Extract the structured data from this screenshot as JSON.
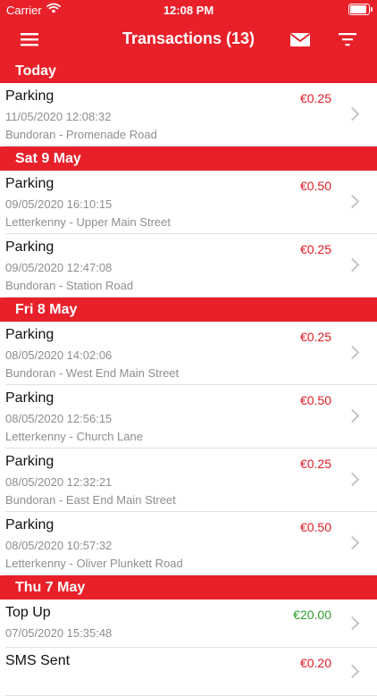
{
  "status": {
    "carrier": "Carrier",
    "time": "12:08 PM",
    "battery_level": 1.0
  },
  "nav": {
    "title": "Transactions (13)"
  },
  "colors": {
    "accent": "#e8202a",
    "negative": "#e01b24",
    "positive": "#2e9a2e"
  },
  "sections": [
    {
      "header": "Today",
      "rows": [
        {
          "title": "Parking",
          "date": "11/05/2020 12:08:32",
          "location": "Bundoran - Promenade Road",
          "amount": "€0.25",
          "type": "negative"
        }
      ]
    },
    {
      "header": "Sat 9 May",
      "rows": [
        {
          "title": "Parking",
          "date": "09/05/2020 16:10:15",
          "location": "Letterkenny - Upper Main Street",
          "amount": "€0.50",
          "type": "negative"
        },
        {
          "title": "Parking",
          "date": "09/05/2020 12:47:08",
          "location": "Bundoran - Station Road",
          "amount": "€0.25",
          "type": "negative"
        }
      ]
    },
    {
      "header": "Fri 8 May",
      "rows": [
        {
          "title": "Parking",
          "date": "08/05/2020 14:02:06",
          "location": "Bundoran - West End Main Street",
          "amount": "€0.25",
          "type": "negative"
        },
        {
          "title": "Parking",
          "date": "08/05/2020 12:56:15",
          "location": "Letterkenny - Church Lane",
          "amount": "€0.50",
          "type": "negative"
        },
        {
          "title": "Parking",
          "date": "08/05/2020 12:32:21",
          "location": "Bundoran - East End Main Street",
          "amount": "€0.25",
          "type": "negative"
        },
        {
          "title": "Parking",
          "date": "08/05/2020 10:57:32",
          "location": "Letterkenny - Oliver Plunkett Road",
          "amount": "€0.50",
          "type": "negative"
        }
      ]
    },
    {
      "header": "Thu 7 May",
      "rows": [
        {
          "title": "Top Up",
          "date": "07/05/2020 15:35:48",
          "location": "",
          "amount": "€20.00",
          "type": "positive"
        },
        {
          "title": "SMS Sent",
          "date": "",
          "location": "",
          "amount": "€0.20",
          "type": "negative"
        }
      ]
    }
  ]
}
